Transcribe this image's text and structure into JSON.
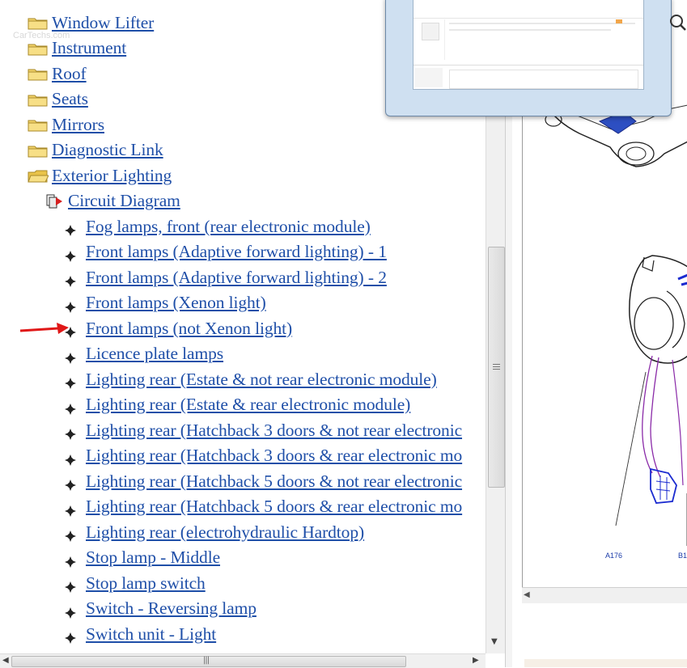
{
  "watermark": "CarTechs.com",
  "tree": {
    "folders": [
      {
        "label": "Window Lifter",
        "open": false
      },
      {
        "label": "Instrument",
        "open": false
      },
      {
        "label": "Roof",
        "open": false
      },
      {
        "label": "Seats",
        "open": false
      },
      {
        "label": "Mirrors",
        "open": false
      },
      {
        "label": "Diagnostic Link",
        "open": false
      },
      {
        "label": "Exterior Lighting",
        "open": true
      }
    ],
    "subfolder": {
      "label": "Circuit Diagram"
    },
    "items": [
      {
        "label": "Fog lamps, front (rear electronic module)"
      },
      {
        "label": "Front lamps (Adaptive forward lighting) - 1"
      },
      {
        "label": "Front lamps (Adaptive forward lighting) - 2"
      },
      {
        "label": "Front lamps (Xenon light)"
      },
      {
        "label": "Front lamps (not Xenon light)"
      },
      {
        "label": "Licence plate lamps"
      },
      {
        "label": "Lighting rear (Estate & not rear electronic module)"
      },
      {
        "label": "Lighting rear (Estate & rear electronic module)"
      },
      {
        "label": "Lighting rear (Hatchback 3 doors & not rear electronic"
      },
      {
        "label": "Lighting rear (Hatchback 3 doors & rear electronic mo"
      },
      {
        "label": "Lighting rear (Hatchback 5 doors & not rear electronic"
      },
      {
        "label": "Lighting rear (Hatchback 5 doors & rear electronic mo"
      },
      {
        "label": "Lighting rear (electrohydraulic Hardtop)"
      },
      {
        "label": "Stop lamp - Middle"
      },
      {
        "label": "Stop lamp switch"
      },
      {
        "label": "Switch - Reversing lamp"
      },
      {
        "label": "Switch unit - Light"
      }
    ]
  },
  "diagram": {
    "labels": {
      "a176": "A176",
      "b1": "B1"
    }
  },
  "colors": {
    "link": "#1f4fa8",
    "arrow": "#e01818",
    "folder": "#f3d46b"
  }
}
